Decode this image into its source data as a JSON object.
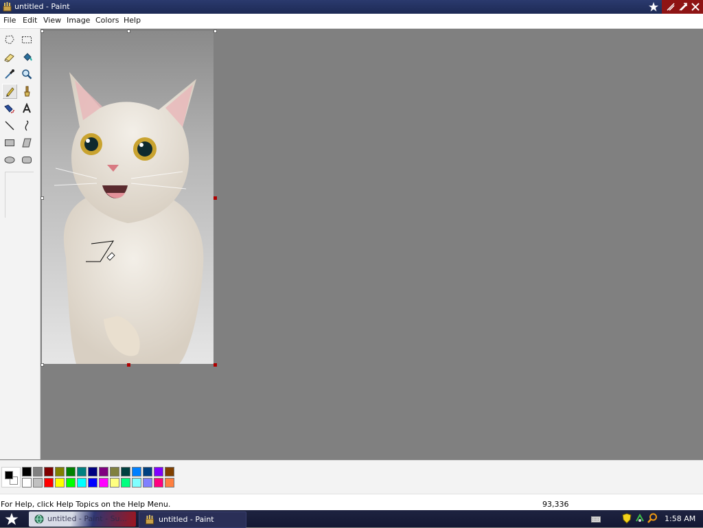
{
  "window": {
    "title": "untitled - Paint"
  },
  "menu": {
    "items": [
      "File",
      "Edit",
      "View",
      "Image",
      "Colors",
      "Help"
    ]
  },
  "toolbox": {
    "tools": [
      {
        "name": "free-form-select",
        "icon": "freeform-select-icon"
      },
      {
        "name": "select",
        "icon": "rect-select-icon"
      },
      {
        "name": "eraser",
        "icon": "eraser-icon"
      },
      {
        "name": "fill-with-color",
        "icon": "paint-bucket-icon"
      },
      {
        "name": "pick-color",
        "icon": "eyedropper-icon"
      },
      {
        "name": "magnifier",
        "icon": "magnifier-icon"
      },
      {
        "name": "pencil",
        "icon": "pencil-icon",
        "active": true
      },
      {
        "name": "brush",
        "icon": "brush-icon"
      },
      {
        "name": "airbrush",
        "icon": "airbrush-icon"
      },
      {
        "name": "text",
        "icon": "text-icon"
      },
      {
        "name": "line",
        "icon": "line-icon"
      },
      {
        "name": "curve",
        "icon": "curve-icon"
      },
      {
        "name": "rectangle",
        "icon": "rectangle-icon"
      },
      {
        "name": "polygon",
        "icon": "polygon-icon"
      },
      {
        "name": "ellipse",
        "icon": "ellipse-icon"
      },
      {
        "name": "rounded-rectangle",
        "icon": "rounded-rect-icon"
      }
    ]
  },
  "palette": {
    "foreground": "#000000",
    "background": "#ffffff",
    "row1": [
      "#000000",
      "#808080",
      "#800000",
      "#808000",
      "#008000",
      "#008080",
      "#000080",
      "#800080",
      "#808040",
      "#004040",
      "#0080ff",
      "#004080",
      "#8000ff",
      "#804000"
    ],
    "row2": [
      "#ffffff",
      "#c0c0c0",
      "#ff0000",
      "#ffff00",
      "#00ff00",
      "#00ffff",
      "#0000ff",
      "#ff00ff",
      "#ffff80",
      "#00ff80",
      "#80ffff",
      "#8080ff",
      "#ff0080",
      "#ff8040"
    ]
  },
  "status": {
    "help_text": "For Help, click Help Topics on the Help Menu.",
    "coordinates": "93,336"
  },
  "taskbar": {
    "tasks": [
      {
        "label": "untitled - Paint - Su..."
      },
      {
        "label": "untitled - Paint"
      }
    ],
    "clock": "1:58 AM"
  }
}
